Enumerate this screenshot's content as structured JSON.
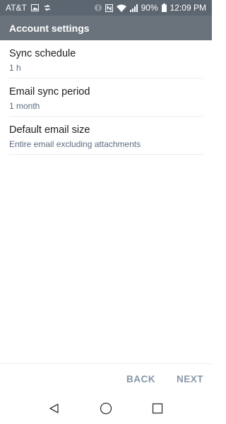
{
  "status_bar": {
    "carrier": "AT&T",
    "battery": "90%",
    "time": "12:09 PM"
  },
  "app_bar": {
    "title": "Account settings"
  },
  "settings": [
    {
      "title": "Sync schedule",
      "value": "1 h"
    },
    {
      "title": "Email sync period",
      "value": "1 month"
    },
    {
      "title": "Default email size",
      "value": "Entire email excluding attachments"
    }
  ],
  "footer": {
    "back_label": "BACK",
    "next_label": "NEXT"
  },
  "colors": {
    "status_bar_bg": "#5c6670",
    "app_bar_bg": "#6a737c",
    "footer_button": "#8796a6",
    "secondary_text": "#5a6b80"
  }
}
